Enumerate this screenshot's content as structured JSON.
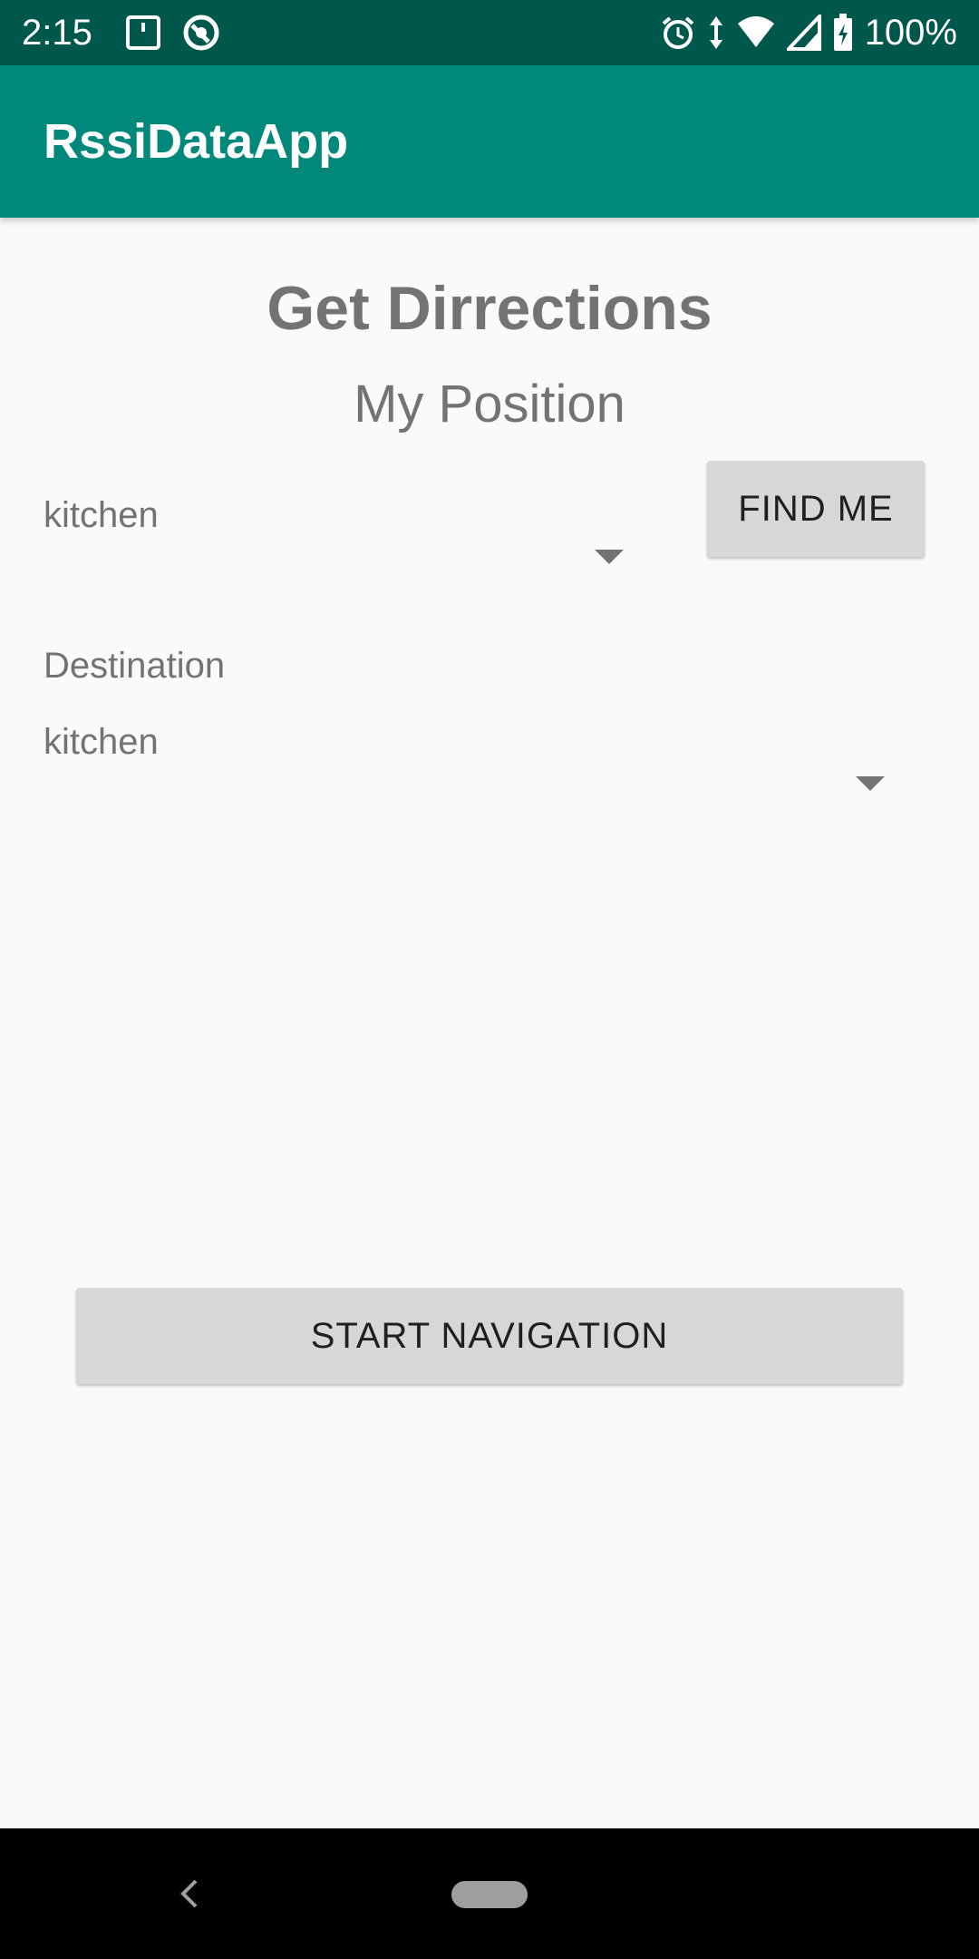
{
  "status_bar": {
    "time": "2:15",
    "battery": "100%",
    "icons": [
      "notification-icon",
      "sync-icon",
      "alarm-icon",
      "data-arrows-icon",
      "wifi-icon",
      "signal-icon",
      "battery-charging-icon"
    ]
  },
  "app_bar": {
    "title": "RssiDataApp",
    "color": "#00897b",
    "status_color": "#00574b"
  },
  "main": {
    "heading": "Get Dirrections",
    "subheading": "My Position",
    "position_spinner": {
      "selected": "kitchen"
    },
    "find_me_label": "FIND ME",
    "destination_label": "Destination",
    "destination_spinner": {
      "selected": "kitchen"
    },
    "start_navigation_label": "START NAVIGATION"
  },
  "nav_bar": {
    "icons": [
      "back-icon",
      "home-pill-icon"
    ]
  }
}
